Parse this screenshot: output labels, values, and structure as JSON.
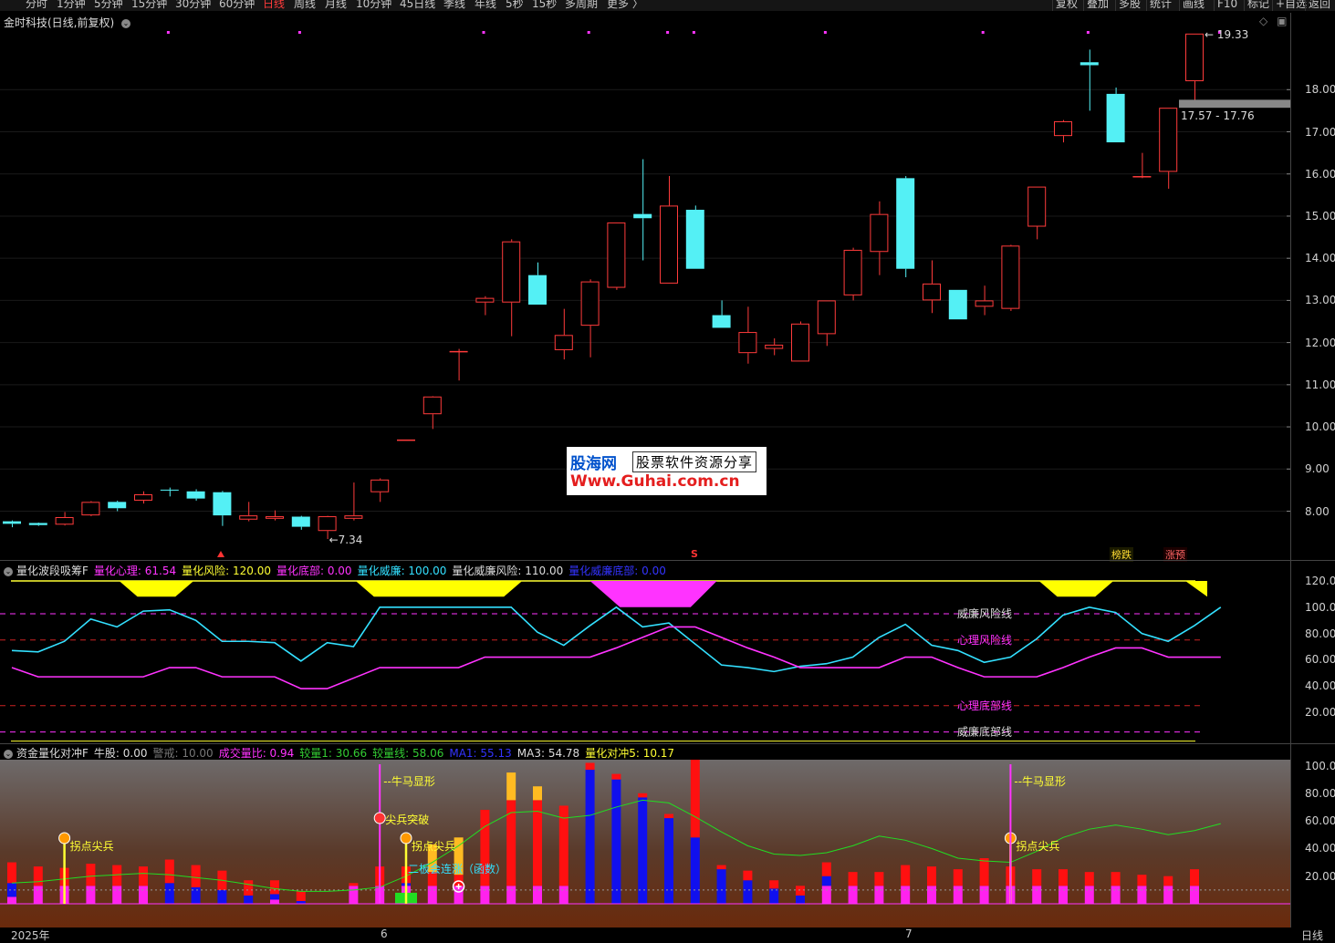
{
  "toolbar": {
    "periods": [
      "分时",
      "1分钟",
      "5分钟",
      "15分钟",
      "30分钟",
      "60分钟",
      "日线",
      "周线",
      "月线",
      "10分钟",
      "45日线",
      "季线",
      "年线",
      "5秒",
      "15秒",
      "多周期",
      "更多 〉"
    ],
    "active_period": "日线",
    "tools": [
      "复权",
      "叠加",
      "多股",
      "统计",
      "画线",
      "F10",
      "标记",
      "+自选",
      "返回"
    ]
  },
  "main_panel": {
    "title": "金时科技(日线,前复权)",
    "price_high_label": "19.33",
    "price_low_label": "7.34",
    "range_label": "17.57 - 17.76",
    "badges": [
      "榜跌",
      "涨预"
    ],
    "marker_s": "S"
  },
  "watermark": {
    "logo": "股海网",
    "tagline": "股票软件资源分享",
    "url": "Www.Guhai.com.cn"
  },
  "panel2": {
    "title": "量化波段吸筹F",
    "indicators": [
      {
        "label": "量化心理: 61.54",
        "color": "#ff33ff"
      },
      {
        "label": "量化风险: 120.00",
        "color": "#ffff33"
      },
      {
        "label": "量化底部: 0.00",
        "color": "#ff33ff"
      },
      {
        "label": "量化威廉: 100.00",
        "color": "#33e0ff"
      },
      {
        "label": "量化威廉风险: 110.00",
        "color": "#dddddd"
      },
      {
        "label": "量化威廉底部: 0.00",
        "color": "#3333ff"
      }
    ],
    "line_labels": [
      {
        "text": "威廉风险线",
        "color": "#dddddd"
      },
      {
        "text": "心理风险线",
        "color": "#ff33ff"
      },
      {
        "text": "心理底部线",
        "color": "#ff33ff"
      },
      {
        "text": "威廉底部线",
        "color": "#dddddd"
      }
    ]
  },
  "panel3": {
    "title": "资金量化对冲F",
    "indicators": [
      {
        "label": "牛股: 0.00",
        "color": "#dddddd"
      },
      {
        "label": "警戒: 10.00",
        "color": "#777777"
      },
      {
        "label": "成交量比: 0.94",
        "color": "#ff33ff"
      },
      {
        "label": "较量1: 30.66",
        "color": "#33cc33"
      },
      {
        "label": "较量线: 58.06",
        "color": "#33cc33"
      },
      {
        "label": "MA1: 55.13",
        "color": "#3333ff"
      },
      {
        "label": "MA3: 54.78",
        "color": "#dddddd"
      },
      {
        "label": "量化对冲5: 10.17",
        "color": "#ffff33"
      }
    ],
    "signals": {
      "niuma": "牛马显形",
      "guaidian": "拐点尖兵",
      "jianbing": "尖兵突破",
      "erban": "二板会连涨（函数）"
    }
  },
  "xaxis": {
    "labels": [
      "2025年",
      "6",
      "7"
    ],
    "period_label": "日线"
  },
  "chart_data": [
    {
      "type": "candlestick",
      "title": "金时科技(日线,前复权)",
      "ylim": [
        7.0,
        20.0
      ],
      "yticks": [
        8,
        9,
        10,
        11,
        12,
        13,
        14,
        15,
        16,
        17,
        18
      ],
      "candles": [
        {
          "o": 7.76,
          "c": 7.7,
          "h": 7.78,
          "l": 7.62
        },
        {
          "o": 7.72,
          "c": 7.67,
          "h": 7.73,
          "l": 7.65
        },
        {
          "o": 7.68,
          "c": 7.86,
          "h": 7.98,
          "l": 7.66
        },
        {
          "o": 7.9,
          "c": 8.22,
          "h": 8.24,
          "l": 7.88
        },
        {
          "o": 8.22,
          "c": 8.07,
          "h": 8.25,
          "l": 8.0
        },
        {
          "o": 8.25,
          "c": 8.4,
          "h": 8.47,
          "l": 8.18
        },
        {
          "o": 8.51,
          "c": 8.5,
          "h": 8.56,
          "l": 8.35
        },
        {
          "o": 8.47,
          "c": 8.3,
          "h": 8.52,
          "l": 8.25
        },
        {
          "o": 8.45,
          "c": 7.9,
          "h": 8.48,
          "l": 7.65
        },
        {
          "o": 7.8,
          "c": 7.9,
          "h": 8.22,
          "l": 7.76
        },
        {
          "o": 7.82,
          "c": 7.88,
          "h": 8.02,
          "l": 7.78
        },
        {
          "o": 7.87,
          "c": 7.63,
          "h": 7.89,
          "l": 7.56
        },
        {
          "o": 7.53,
          "c": 7.88,
          "h": 7.89,
          "l": 7.34
        },
        {
          "o": 7.82,
          "c": 7.9,
          "h": 8.68,
          "l": 7.78
        },
        {
          "o": 8.45,
          "c": 8.75,
          "h": 8.78,
          "l": 8.22
        },
        {
          "o": 9.7,
          "c": 9.7,
          "h": 9.7,
          "l": 9.7
        },
        {
          "o": 10.3,
          "c": 10.72,
          "h": 10.73,
          "l": 9.95
        },
        {
          "o": 11.8,
          "c": 11.8,
          "h": 11.85,
          "l": 11.1
        },
        {
          "o": 12.95,
          "c": 13.06,
          "h": 13.1,
          "l": 12.65
        },
        {
          "o": 12.95,
          "c": 14.4,
          "h": 14.45,
          "l": 12.15
        },
        {
          "o": 13.6,
          "c": 12.9,
          "h": 13.9,
          "l": 12.9
        },
        {
          "o": 11.82,
          "c": 12.18,
          "h": 12.8,
          "l": 11.6
        },
        {
          "o": 12.4,
          "c": 13.45,
          "h": 13.5,
          "l": 11.65
        },
        {
          "o": 13.3,
          "c": 14.85,
          "h": 14.85,
          "l": 13.25
        },
        {
          "o": 15.05,
          "c": 14.95,
          "h": 16.35,
          "l": 13.95
        },
        {
          "o": 13.4,
          "c": 15.25,
          "h": 15.95,
          "l": 13.4
        },
        {
          "o": 15.15,
          "c": 13.75,
          "h": 15.25,
          "l": 13.75
        },
        {
          "o": 12.65,
          "c": 12.35,
          "h": 13.0,
          "l": 12.35
        },
        {
          "o": 11.75,
          "c": 12.25,
          "h": 12.85,
          "l": 11.5
        },
        {
          "o": 11.85,
          "c": 11.95,
          "h": 12.1,
          "l": 11.7
        },
        {
          "o": 11.55,
          "c": 12.45,
          "h": 12.5,
          "l": 11.55
        },
        {
          "o": 12.2,
          "c": 13.0,
          "h": 13.0,
          "l": 11.92
        },
        {
          "o": 13.12,
          "c": 14.2,
          "h": 14.25,
          "l": 13.0
        },
        {
          "o": 14.15,
          "c": 15.05,
          "h": 15.35,
          "l": 13.6
        },
        {
          "o": 15.9,
          "c": 13.75,
          "h": 15.95,
          "l": 13.55
        },
        {
          "o": 13.0,
          "c": 13.4,
          "h": 13.95,
          "l": 12.7
        },
        {
          "o": 13.25,
          "c": 12.55,
          "h": 13.25,
          "l": 12.55
        },
        {
          "o": 12.85,
          "c": 13.0,
          "h": 13.35,
          "l": 12.65
        },
        {
          "o": 12.8,
          "c": 14.3,
          "h": 14.32,
          "l": 12.75
        },
        {
          "o": 14.75,
          "c": 15.7,
          "h": 15.7,
          "l": 14.45
        },
        {
          "o": 16.9,
          "c": 17.25,
          "h": 17.28,
          "l": 16.75
        },
        {
          "o": 18.65,
          "c": 18.58,
          "h": 18.95,
          "l": 17.5
        },
        {
          "o": 17.9,
          "c": 16.75,
          "h": 18.05,
          "l": 16.75
        },
        {
          "o": 15.95,
          "c": 15.95,
          "h": 16.5,
          "l": 15.9
        },
        {
          "o": 16.05,
          "c": 17.57,
          "h": 17.57,
          "l": 15.65
        },
        {
          "o": 18.2,
          "c": 19.33,
          "h": 19.33,
          "l": 17.75
        }
      ]
    },
    {
      "type": "line",
      "title": "量化波段吸筹F",
      "ylim": [
        0,
        125
      ],
      "yticks": [
        20,
        40,
        60,
        80,
        100,
        120
      ],
      "series": [
        {
          "name": "量化威廉",
          "color": "#33e0ff",
          "values": [
            67,
            66,
            74,
            91,
            85,
            97,
            98,
            90,
            74,
            74,
            73,
            59,
            73,
            70,
            100,
            100,
            100,
            100,
            100,
            100,
            81,
            71,
            86,
            100,
            85,
            88,
            72,
            56,
            54,
            51,
            55,
            57,
            62,
            77,
            87,
            71,
            67,
            58,
            62,
            76,
            94,
            100,
            96,
            80,
            74,
            86,
            100
          ]
        },
        {
          "name": "量化心理",
          "color": "#ff33ff",
          "values": [
            54,
            47,
            47,
            47,
            47,
            47,
            54,
            54,
            47,
            47,
            47,
            38,
            38,
            46,
            54,
            54,
            54,
            54,
            62,
            62,
            62,
            62,
            62,
            69,
            77,
            85,
            85,
            77,
            69,
            62,
            54,
            54,
            54,
            54,
            62,
            62,
            54,
            47,
            47,
            47,
            54,
            62,
            69,
            69,
            62,
            62,
            62
          ]
        }
      ],
      "reference_lines": [
        {
          "name": "威廉风险线",
          "value": 95
        },
        {
          "name": "心理风险线",
          "value": 75
        },
        {
          "name": "心理底部线",
          "value": 25
        },
        {
          "name": "威廉底部线",
          "value": 5
        }
      ]
    },
    {
      "type": "bar",
      "title": "资金量化对冲F",
      "ylim": [
        0,
        105
      ],
      "yticks": [
        20,
        40,
        60,
        80,
        100
      ],
      "series": [
        {
          "name": "red",
          "values": [
            15,
            14,
            13,
            16,
            15,
            14,
            17,
            16,
            14,
            11,
            10,
            7,
            0,
            2,
            14,
            12,
            10,
            8,
            55,
            62,
            62,
            58,
            5,
            4,
            3,
            3,
            60,
            3,
            7,
            6,
            7,
            10,
            10,
            10,
            15,
            14,
            12,
            20,
            14,
            12,
            12,
            10,
            10,
            8,
            7,
            12,
            7
          ]
        },
        {
          "name": "blue",
          "values": [
            10,
            0,
            0,
            0,
            0,
            0,
            15,
            12,
            10,
            6,
            4,
            2,
            0,
            0,
            0,
            2,
            0,
            0,
            0,
            0,
            0,
            0,
            97,
            90,
            77,
            62,
            48,
            25,
            17,
            11,
            6,
            7,
            0,
            0,
            0,
            0,
            0,
            0,
            0,
            0,
            0,
            0,
            0,
            0,
            0,
            0,
            58
          ]
        },
        {
          "name": "magenta",
          "values": [
            5,
            13,
            13,
            13,
            13,
            13,
            0,
            0,
            0,
            0,
            3,
            0,
            0,
            13,
            13,
            13,
            13,
            13,
            13,
            13,
            13,
            13,
            0,
            0,
            0,
            0,
            0,
            0,
            0,
            0,
            0,
            13,
            13,
            13,
            13,
            13,
            13,
            13,
            13,
            13,
            13,
            13,
            13,
            13,
            13,
            13,
            0
          ]
        },
        {
          "name": "yellow",
          "values": [
            0,
            0,
            0,
            0,
            0,
            0,
            0,
            0,
            0,
            0,
            0,
            0,
            0,
            0,
            0,
            0,
            20,
            27,
            0,
            20,
            10,
            0,
            0,
            0,
            0,
            0,
            0,
            0,
            0,
            0,
            0,
            0,
            0,
            0,
            0,
            0,
            0,
            0,
            0,
            0,
            0,
            0,
            0,
            0,
            0,
            0,
            0
          ]
        }
      ],
      "line": {
        "name": "较量线",
        "values": [
          15,
          16,
          18,
          20,
          21,
          22,
          21,
          19,
          17,
          14,
          11,
          9,
          9,
          10,
          12,
          20,
          30,
          42,
          56,
          66,
          67,
          62,
          64,
          70,
          75,
          73,
          63,
          52,
          42,
          36,
          35,
          37,
          42,
          49,
          46,
          40,
          33,
          31,
          30,
          38,
          48,
          54,
          57,
          54,
          50,
          53,
          58
        ]
      }
    }
  ]
}
